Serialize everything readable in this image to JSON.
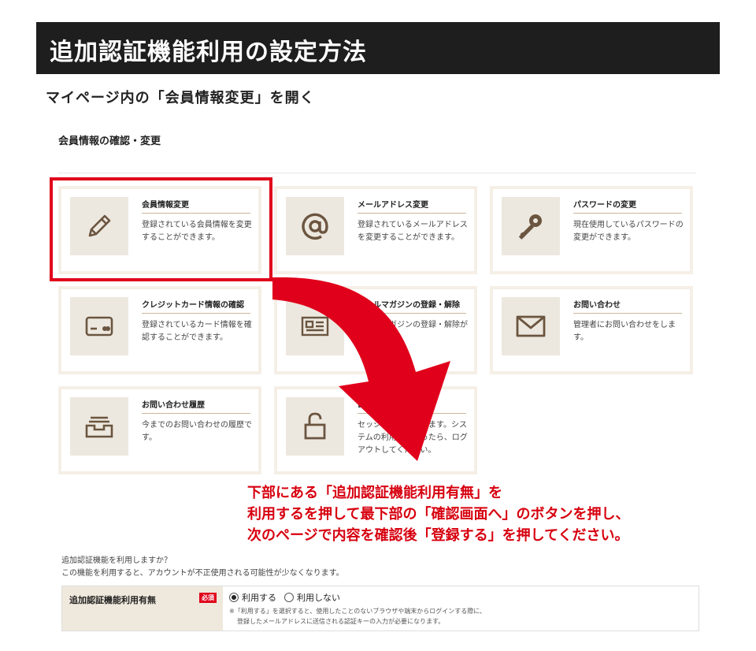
{
  "title": "追加認証機能利用の設定方法",
  "step_heading": "マイページ内の「会員情報変更」を開く",
  "section_label": "会員情報の確認・変更",
  "cards": [
    {
      "title": "会員情報変更",
      "desc": "登録されている会員情報を変更することができます。",
      "icon": "pencil-icon"
    },
    {
      "title": "メールアドレス変更",
      "desc": "登録されているメールアドレスを変更することができます。",
      "icon": "at-icon"
    },
    {
      "title": "パスワードの変更",
      "desc": "現在使用しているパスワードの変更ができます。",
      "icon": "key-icon"
    },
    {
      "title": "クレジットカード情報の確認",
      "desc": "登録されているカード情報を確認することができます。",
      "icon": "credit-card-icon"
    },
    {
      "title": "メールマガジンの登録・解除",
      "desc": "メールマガジンの登録・解除ができます。",
      "icon": "newsletter-icon"
    },
    {
      "title": "お問い合わせ",
      "desc": "管理者にお問い合わせをします。",
      "icon": "envelope-icon"
    },
    {
      "title": "お問い合わせ履歴",
      "desc": "今までのお問い合わせの履歴です。",
      "icon": "inbox-tray-icon"
    },
    {
      "title": "ログアウト",
      "desc": "セッションを終了します。システムの利用が終わったら、ログアウトしてください。",
      "icon": "unlock-icon"
    }
  ],
  "instruction_lines": [
    "下部にある「追加認証機能利用有無」を",
    "利用するを押して最下部の「確認画面へ」のボタンを押し、",
    "次のページで内容を確認後「登録する」を押してください。"
  ],
  "question_lines": [
    "追加認証機能を利用しますか？",
    "この機能を利用すると、アカウントが不正使用される可能性が少なくなります。"
  ],
  "form": {
    "label": "追加認証機能利用有無",
    "required": "必須",
    "option_use": "利用する",
    "option_not_use": "利用しない",
    "selected": "利用する",
    "note_lines": [
      "※「利用する」を選択すると、使用したことのないブラウザや端末からログインする際に、",
      "登録したメールアドレスに送信される認証キーの入力が必要になります。"
    ]
  },
  "colors": {
    "accent_red": "#e0001b",
    "title_bg": "#1e1e1e",
    "icon_brown": "#6b5540",
    "card_border": "#f5efe6"
  }
}
